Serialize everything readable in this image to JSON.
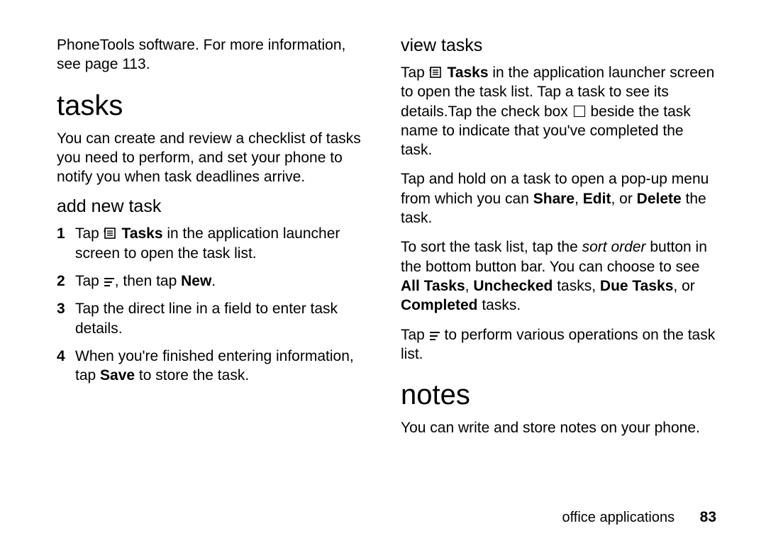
{
  "col1": {
    "intro": {
      "prefix": "PhoneTools software. For more information, see page ",
      "pageref": "113",
      "suffix": "."
    },
    "h_tasks": "tasks",
    "tasks_intro": "You can create and review a checklist of tasks you need to perform, and set your phone to notify you when task deadlines arrive.",
    "h_add": "add new task",
    "steps": {
      "s1": {
        "num": "1",
        "a": "Tap ",
        "tasks": "Tasks",
        "b": " in the application launcher screen to open the task list."
      },
      "s2": {
        "num": "2",
        "a": "Tap ",
        "b": ", then tap ",
        "new": "New",
        "c": "."
      },
      "s3": {
        "num": "3",
        "a": "Tap the direct line in a field to enter task details."
      },
      "s4": {
        "num": "4",
        "a": "When you're finished entering information, tap ",
        "save": "Save",
        "b": " to store the task."
      }
    }
  },
  "col2": {
    "h_view": "view tasks",
    "p1": {
      "a": "Tap ",
      "tasks": "Tasks",
      "b": " in the application launcher screen to open the task list. Tap a task to see its details.Tap the check box ",
      "c": " beside the task name to indicate that you've completed the task."
    },
    "p2": {
      "a": "Tap and hold on a task to open a pop-up menu from which you can ",
      "share": "Share",
      "sep1": ", ",
      "edit": "Edit",
      "sep2": ", or ",
      "delete": "Delete",
      "b": " the task."
    },
    "p3": {
      "a": "To sort the task list, tap the ",
      "sortorder": "sort order",
      "b": " button in the bottom button bar. You can choose to see ",
      "all": "All Tasks",
      "sep1": ", ",
      "unchecked": "Unchecked",
      "c": " tasks, ",
      "due": "Due Tasks",
      "sep2": ", or ",
      "completed": "Completed",
      "d": " tasks."
    },
    "p4": {
      "a": "Tap ",
      "b": " to perform various operations on the task list."
    },
    "h_notes": "notes",
    "notes_intro": "You can write and store notes on your phone."
  },
  "footer": {
    "section": "office applications",
    "page": "83"
  }
}
